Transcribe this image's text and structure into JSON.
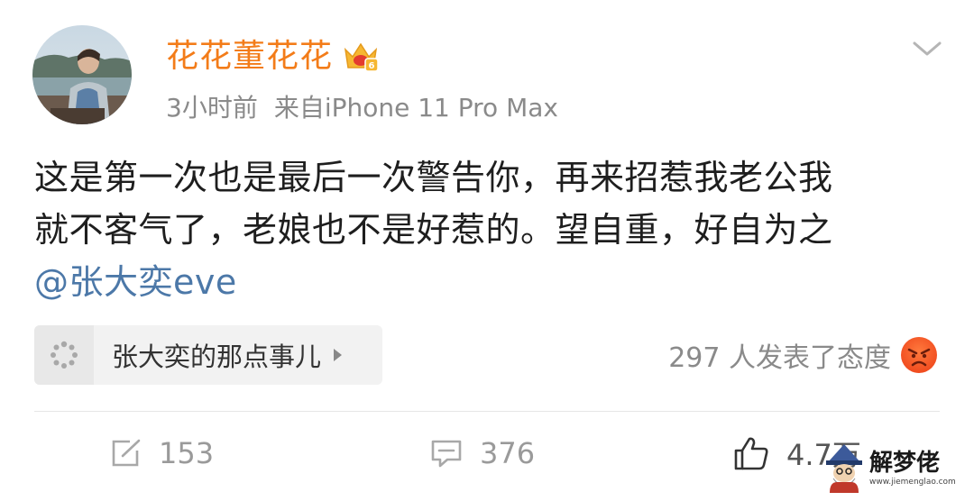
{
  "post": {
    "username": "花花董花花",
    "time": "3小时前",
    "source": "来自iPhone 11 Pro Max",
    "text_lines": [
      "这是第一次也是最后一次警告你，再来招惹我老公我",
      "就不客气了，老娘也不是好惹的。望自重，好自为之"
    ],
    "mention": "@张大奕eve"
  },
  "topic": {
    "label": "张大奕的那点事儿"
  },
  "reaction": {
    "text": "297 人发表了态度",
    "emoji": "angry-face"
  },
  "actions": {
    "repost_count": "153",
    "comment_count": "376",
    "like_count": "4.7万"
  },
  "watermark": {
    "title": "解梦佬",
    "url": "www.jiemenglao.com"
  },
  "colors": {
    "username": "#f37c19",
    "mention": "#4c78a8",
    "text": "#1e1e1e",
    "meta": "#8a8a8a"
  }
}
